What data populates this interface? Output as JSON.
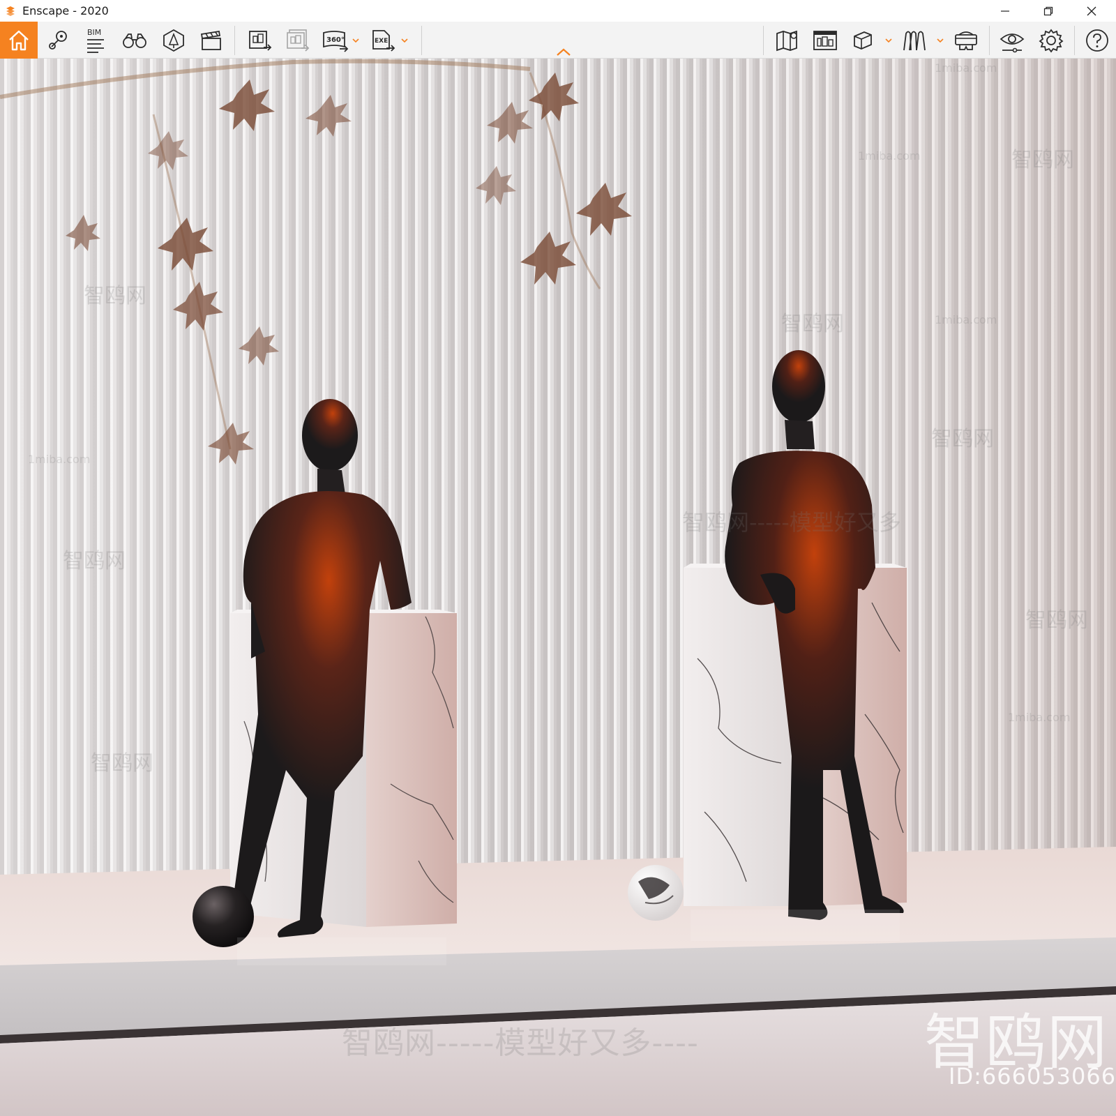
{
  "window": {
    "title": "Enscape - 2020"
  },
  "toolbar": {
    "items": [
      {
        "icon": "home-icon",
        "active": true
      },
      {
        "icon": "map-pin-icon"
      },
      {
        "icon": "bim-icon",
        "label": "BIM"
      },
      {
        "icon": "binoculars-icon"
      },
      {
        "icon": "asset-library-icon"
      },
      {
        "icon": "clapperboard-icon"
      },
      {
        "icon": "render-screenshot-icon"
      },
      {
        "icon": "batch-render-icon"
      },
      {
        "icon": "panorama-360-icon",
        "label": "360°"
      },
      {
        "icon": "export-exe-icon",
        "label": "EXE"
      },
      {
        "icon": "minimap-icon"
      },
      {
        "icon": "info-panel-icon"
      },
      {
        "icon": "cube-view-icon"
      },
      {
        "icon": "walk-mode-icon"
      },
      {
        "icon": "vr-headset-icon"
      },
      {
        "icon": "visual-settings-icon"
      },
      {
        "icon": "gear-icon"
      },
      {
        "icon": "help-icon"
      }
    ],
    "accent_color": "#f58220"
  },
  "viewport": {
    "watermarks": {
      "brand": "智鸥网",
      "id": "ID:666053066",
      "slogan": "智鸥网-----模型好又多----",
      "site": "1miba.com",
      "small_slogan": "智鸥网-----模型好又多"
    }
  }
}
